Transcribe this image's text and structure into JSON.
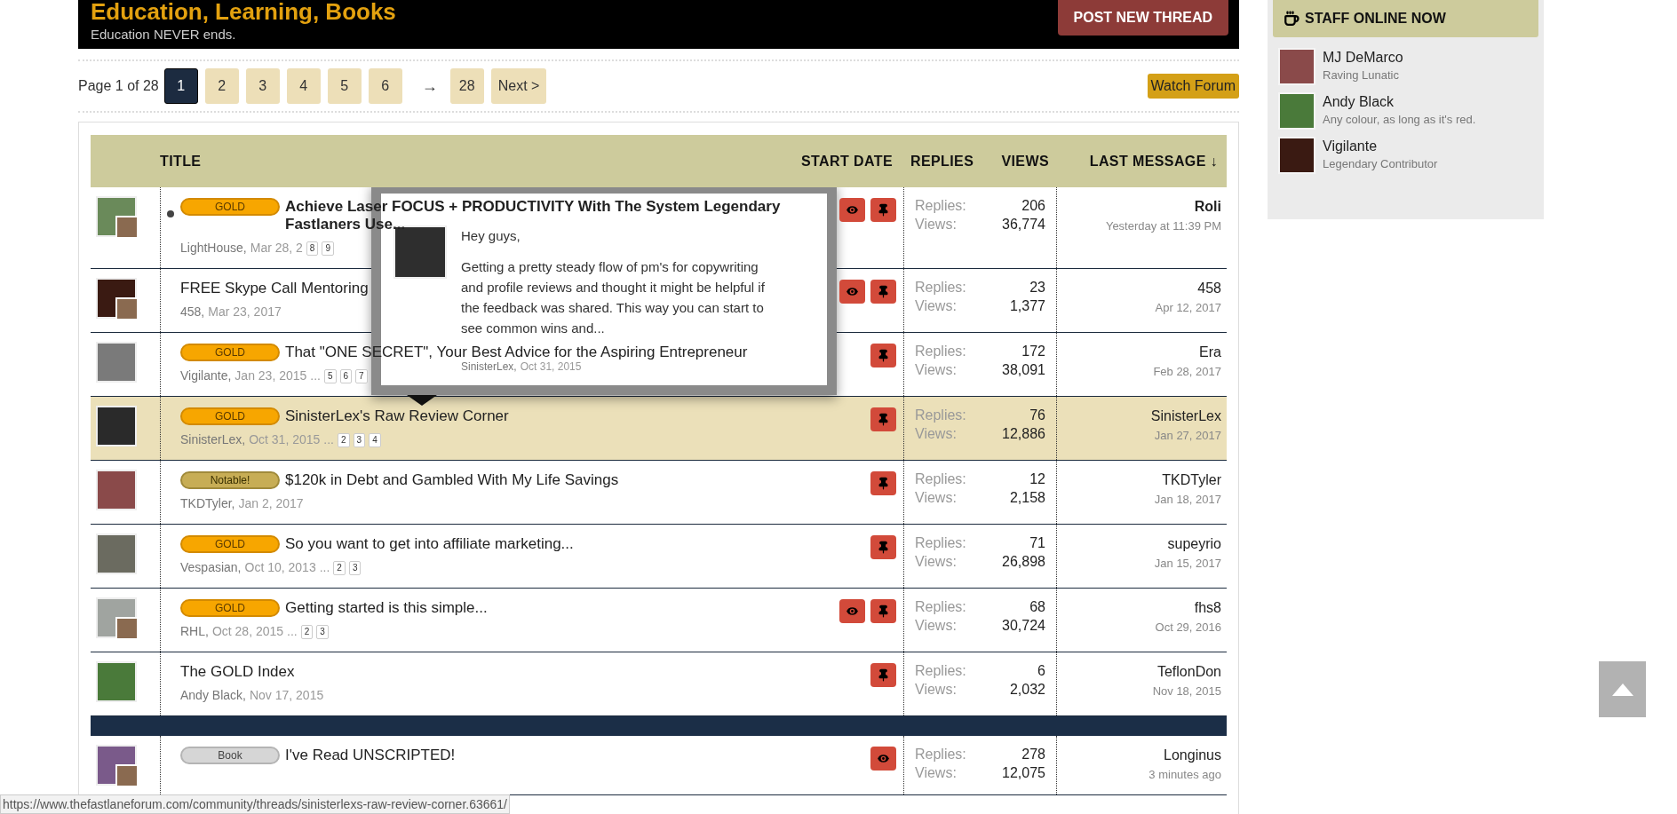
{
  "forum_header": {
    "title": "Education, Learning, Books",
    "description": "Education NEVER ends.",
    "post_button": "POST NEW THREAD"
  },
  "pagination": {
    "label": "Page 1 of 28",
    "pages": [
      {
        "label": "1",
        "selected": true
      },
      {
        "label": "2",
        "selected": false
      },
      {
        "label": "3",
        "selected": false
      },
      {
        "label": "4",
        "selected": false
      },
      {
        "label": "5",
        "selected": false
      },
      {
        "label": "6",
        "selected": false
      }
    ],
    "gap": "→",
    "last_pages": [
      {
        "label": "28",
        "selected": false
      },
      {
        "label": "Next >",
        "selected": false
      }
    ]
  },
  "watch_button": "Watch Forum",
  "table": {
    "columns": [
      "TITLE",
      "START DATE",
      "REPLIES",
      "VIEWS",
      "LAST MESSAGE ↓"
    ],
    "sticky_threads": [
      {
        "unread": true,
        "highlighted": false,
        "poster_avatar": true,
        "prefix": {
          "kind": "gold",
          "label": "GOLD"
        },
        "title": "Achieve Laser FOCUS + PRODUCTIVITY With The System Legendary Fastlaners Use...",
        "author": "LightHouse,",
        "date": "Mar 28, 2",
        "pages": [
          "8",
          "9"
        ],
        "watched": true,
        "sticky": true,
        "replies_label": "Replies:",
        "replies": "206",
        "views_label": "Views:",
        "views": "36,774",
        "last_user": "Roli",
        "last_date": "Yesterday at 11:39 PM"
      },
      {
        "unread": false,
        "highlighted": false,
        "poster_avatar": true,
        "title": "FREE Skype Call Mentoring",
        "author": "458,",
        "date": "Mar 23, 2017",
        "watched": true,
        "sticky": true,
        "replies_label": "Replies:",
        "replies": "23",
        "views_label": "Views:",
        "views": "1,377",
        "last_user": "458",
        "last_date": "Apr 12, 2017"
      },
      {
        "unread": false,
        "highlighted": false,
        "poster_avatar": false,
        "prefix": {
          "kind": "gold",
          "label": "GOLD"
        },
        "title": "That \"ONE SECRET\", Your Best Advice for the Aspiring Entrepreneur",
        "author": "Vigilante,",
        "date": "Jan 23, 2015",
        "ellipsis": "...",
        "pages": [
          "5",
          "6",
          "7"
        ],
        "watched": false,
        "sticky": true,
        "replies_label": "Replies:",
        "replies": "172",
        "views_label": "Views:",
        "views": "38,091",
        "last_user": "Era",
        "last_date": "Feb 28, 2017"
      },
      {
        "unread": false,
        "highlighted": true,
        "poster_avatar": false,
        "prefix": {
          "kind": "gold",
          "label": "GOLD"
        },
        "title": "SinisterLex's Raw Review Corner",
        "author": "SinisterLex,",
        "date": "Oct 31, 2015",
        "ellipsis": "...",
        "pages": [
          "2",
          "3",
          "4"
        ],
        "watched": false,
        "sticky": true,
        "replies_label": "Replies:",
        "replies": "76",
        "views_label": "Views:",
        "views": "12,886",
        "last_user": "SinisterLex",
        "last_date": "Jan 27, 2017"
      },
      {
        "unread": false,
        "highlighted": false,
        "poster_avatar": false,
        "prefix": {
          "kind": "notable",
          "label": "Notable!"
        },
        "title": "$120k in Debt and Gambled With My Life Savings",
        "author": "TKDTyler,",
        "date": "Jan 2, 2017",
        "watched": false,
        "sticky": true,
        "replies_label": "Replies:",
        "replies": "12",
        "views_label": "Views:",
        "views": "2,158",
        "last_user": "TKDTyler",
        "last_date": "Jan 18, 2017"
      },
      {
        "unread": false,
        "highlighted": false,
        "poster_avatar": false,
        "prefix": {
          "kind": "gold",
          "label": "GOLD"
        },
        "title": "So you want to get into affiliate marketing...",
        "author": "Vespasian,",
        "date": "Oct 10, 2013",
        "ellipsis": "...",
        "pages": [
          "2",
          "3"
        ],
        "watched": false,
        "sticky": true,
        "replies_label": "Replies:",
        "replies": "71",
        "views_label": "Views:",
        "views": "26,898",
        "last_user": "supeyrio",
        "last_date": "Jan 15, 2017"
      },
      {
        "unread": false,
        "highlighted": false,
        "poster_avatar": true,
        "prefix": {
          "kind": "gold",
          "label": "GOLD"
        },
        "title": "Getting started is this simple...",
        "author": "RHL,",
        "date": "Oct 28, 2015",
        "ellipsis": "...",
        "pages": [
          "2",
          "3"
        ],
        "watched": true,
        "sticky": true,
        "replies_label": "Replies:",
        "replies": "68",
        "views_label": "Views:",
        "views": "30,724",
        "last_user": "fhs8",
        "last_date": "Oct 29, 2016"
      },
      {
        "unread": false,
        "highlighted": false,
        "poster_avatar": false,
        "title": "The GOLD Index",
        "author": "Andy Black,",
        "date": "Nov 17, 2015",
        "watched": false,
        "sticky": true,
        "replies_label": "Replies:",
        "replies": "6",
        "views_label": "Views:",
        "views": "2,032",
        "last_user": "TeflonDon",
        "last_date": "Nov 18, 2015"
      }
    ],
    "threads": [
      {
        "unread": false,
        "highlighted": false,
        "poster_avatar": true,
        "prefix": {
          "kind": "book",
          "label": "Book"
        },
        "title": "I've Read UNSCRIPTED!",
        "watched": true,
        "sticky": false,
        "replies_label": "Replies:",
        "replies": "278",
        "views_label": "Views:",
        "views": "12,075",
        "last_user": "Longinus",
        "last_date": "3 minutes ago"
      }
    ]
  },
  "preview": {
    "paragraphs": [
      "Hey guys,",
      "Getting a pretty steady flow of pm's for copywriting and profile reviews and thought it might be helpful if the feedback was shared. This way you can start to see common wins and..."
    ],
    "author": "SinisterLex,",
    "date": "Oct 31, 2015"
  },
  "sidebar": {
    "title": "STAFF ONLINE NOW",
    "staff": [
      {
        "name": "MJ DeMarco",
        "title": "Raving Lunatic"
      },
      {
        "name": "Andy Black",
        "title": "Any colour, as long as it's red."
      },
      {
        "name": "Vigilante",
        "title": "Legendary Contributor"
      }
    ]
  },
  "status_url": "https://www.thefastlaneforum.com/community/threads/sinisterlexs-raw-review-corner.63661/"
}
